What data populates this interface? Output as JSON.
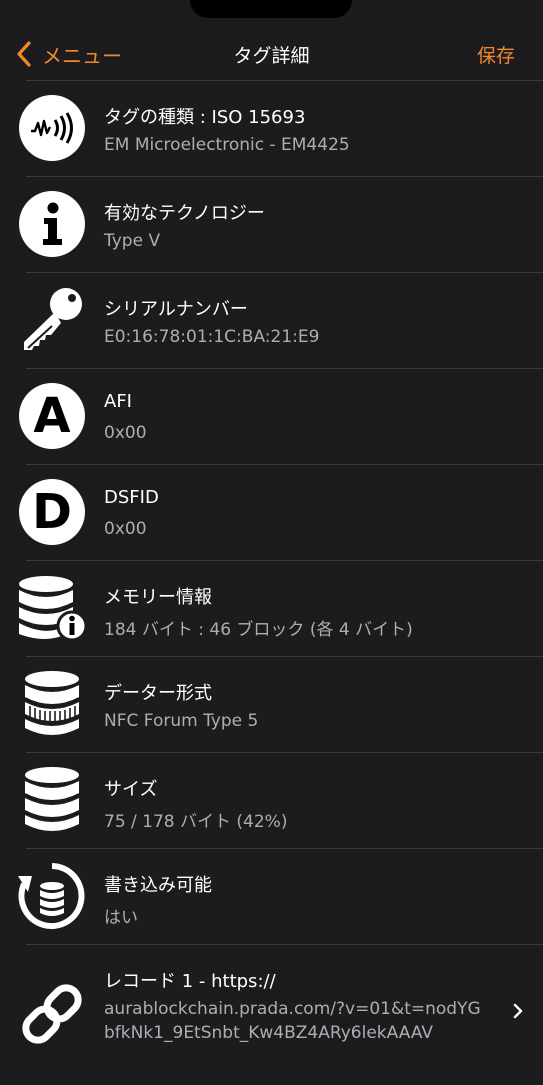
{
  "navbar": {
    "back_label": "メニュー",
    "title": "タグ詳細",
    "save_label": "保存"
  },
  "rows": [
    {
      "label": "タグの種類 : ISO 15693",
      "value": "EM Microelectronic - EM4425",
      "icon": "nfc-wave-icon"
    },
    {
      "label": "有効なテクノロジー",
      "value": "Type V",
      "icon": "info-icon"
    },
    {
      "label": "シリアルナンバー",
      "value": "E0:16:78:01:1C:BA:21:E9",
      "icon": "key-icon"
    },
    {
      "label": "AFI",
      "value": "0x00",
      "icon": "letter-a-icon"
    },
    {
      "label": "DSFID",
      "value": "0x00",
      "icon": "letter-d-icon"
    },
    {
      "label": "メモリー情報",
      "value": "184 バイト : 46 ブロック (各 4 バイト)",
      "icon": "database-info-icon"
    },
    {
      "label": "データー形式",
      "value": "NFC Forum Type 5",
      "icon": "database-format-icon"
    },
    {
      "label": "サイズ",
      "value": "75 / 178 バイト (42%)",
      "icon": "database-icon"
    },
    {
      "label": "書き込み可能",
      "value": "はい",
      "icon": "database-refresh-icon"
    },
    {
      "label": "レコード 1 - https://",
      "value": "aurablockchain.prada.com/?v=01&t=nodYGbfkNk1_9EtSnbt_Kw4BZ4ARy6lekAAAV",
      "icon": "link-icon"
    }
  ],
  "colors": {
    "accent": "#f0892a",
    "background": "#1c1c1e",
    "secondary_text": "#aeaeb2"
  }
}
